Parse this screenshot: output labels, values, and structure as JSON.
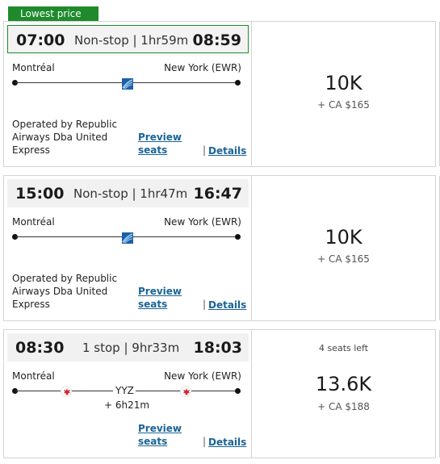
{
  "badge": "Lowest price",
  "flights": [
    {
      "depart": "07:00",
      "stops": "Non-stop | 1hr59m",
      "arrive": "08:59",
      "from": "Montréal",
      "to": "New York (EWR)",
      "operated": "Operated by Republic Airways Dba United Express",
      "preview": "Preview seats",
      "details": "Details",
      "sep": "|",
      "price": "10K",
      "fee": "+ CA $165"
    },
    {
      "depart": "15:00",
      "stops": "Non-stop | 1hr47m",
      "arrive": "16:47",
      "from": "Montréal",
      "to": "New York (EWR)",
      "operated": "Operated by Republic Airways Dba United Express",
      "preview": "Preview seats",
      "details": "Details",
      "sep": "|",
      "price": "10K",
      "fee": "+ CA $165"
    },
    {
      "depart": "08:30",
      "stops": "1 stop | 9hr33m",
      "arrive": "18:03",
      "from": "Montréal",
      "to": "New York (EWR)",
      "via": "YYZ",
      "layover": "+ 6h21m",
      "preview": "Preview seats",
      "details": "Details",
      "sep": "|",
      "seats_left": "4 seats left",
      "price": "13.6K",
      "fee": "+ CA $188"
    }
  ],
  "icons": {
    "united": "united-airlines-logo-icon",
    "aircanada": "air-canada-logo-icon"
  },
  "colors": {
    "accent": "#1e8a2c",
    "link": "#1a6496",
    "aircanada": "#d22630",
    "united": "#1d5fa8"
  }
}
